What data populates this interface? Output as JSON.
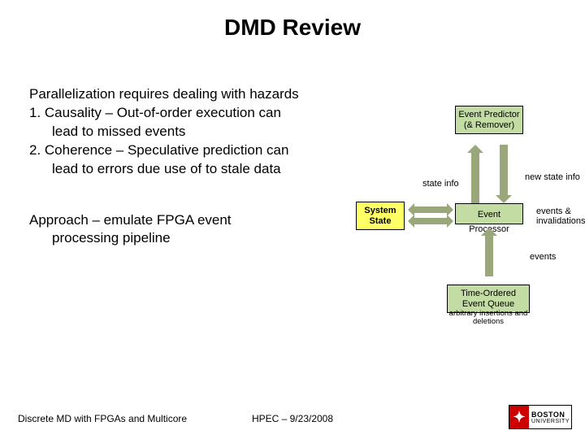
{
  "title": "DMD Review",
  "text": {
    "p1": "Parallelization requires dealing with hazards",
    "p2": "1.  Causality – Out-of-order execution can",
    "p3": "lead to missed events",
    "p4": "2.  Coherence – Speculative prediction can",
    "p5": "lead to errors due use of to stale data"
  },
  "approach": {
    "l1": "Approach – emulate FPGA event",
    "l2": "processing pipeline"
  },
  "diagram": {
    "predictor": "Event Predictor (& Remover)",
    "processor": "Event Processor",
    "queue": "Time-Ordered Event Queue",
    "queue_sub": "arbitrary insertions and deletions",
    "system_state": "System State",
    "state_info": "state info",
    "new_state": "new state info",
    "events_inv": "events & invalidations",
    "events_only": "events"
  },
  "footer": {
    "left": "Discrete MD with FPGAs and Multicore",
    "center": "HPEC  –  9/23/2008"
  },
  "logo": {
    "line1": "BOSTON",
    "line2": "UNIVERSITY"
  }
}
